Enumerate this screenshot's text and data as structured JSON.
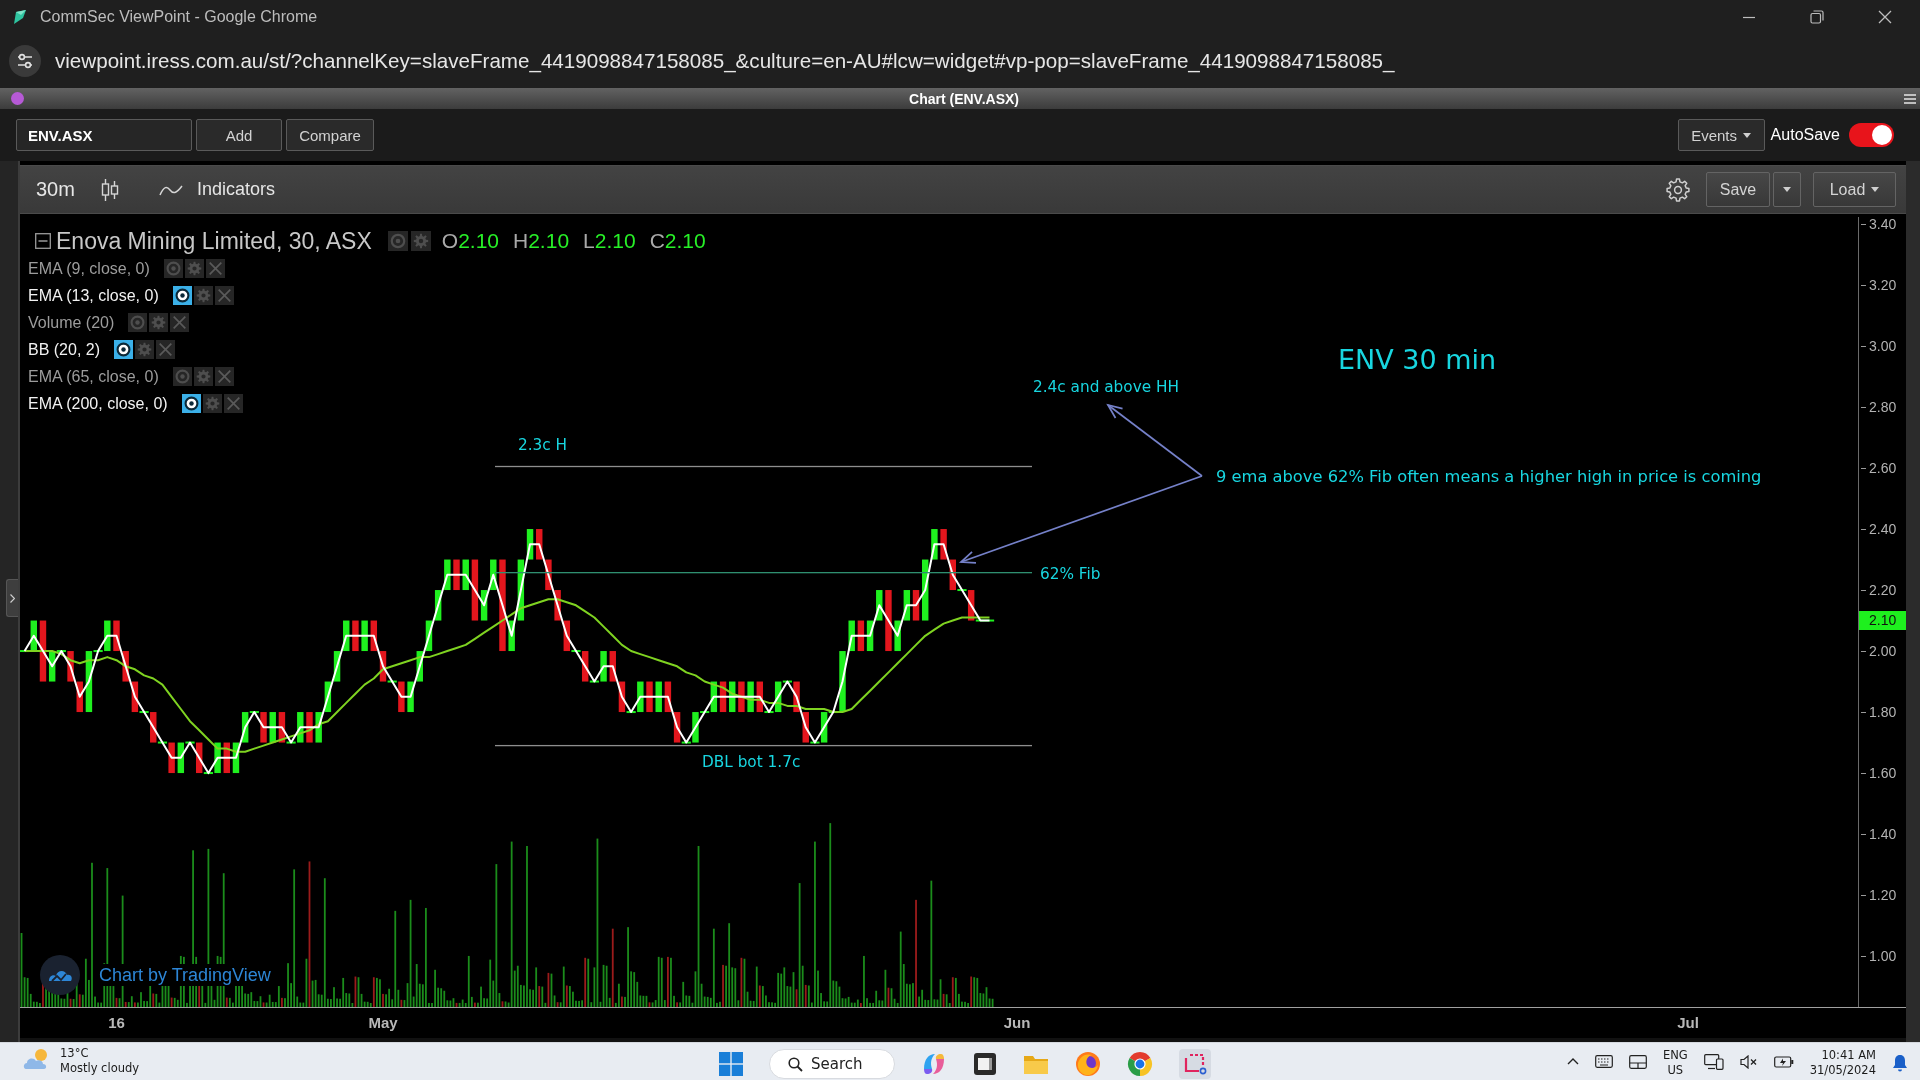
{
  "browser": {
    "title": "CommSec ViewPoint - Google Chrome",
    "url": "viewpoint.iress.com.au/st/?channelKey=slaveFrame_4419098847158085_&culture=en-AU#lcw=widget#vp-pop=slaveFrame_4419098847158085_"
  },
  "panel": {
    "title": "Chart (ENV.ASX)"
  },
  "toolbar": {
    "symbol": "ENV.ASX",
    "buttons": [
      "Add",
      "Compare"
    ],
    "events": "Events",
    "autosave": {
      "label": "AutoSave",
      "on": true
    }
  },
  "chart_toolbar": {
    "interval": "30m",
    "indicators": "Indicators",
    "save": "Save",
    "load": "Load"
  },
  "chart": {
    "legend": {
      "title": "Enova Mining Limited, 30, ASX",
      "ohlc": [
        {
          "label": "O",
          "value": "2.10"
        },
        {
          "label": "H",
          "value": "2.10"
        },
        {
          "label": "L",
          "value": "2.10"
        },
        {
          "label": "C",
          "value": "2.10"
        }
      ],
      "studies": [
        {
          "label": "EMA (9, close, 0)",
          "visible": false
        },
        {
          "label": "EMA (13, close, 0)",
          "visible": true
        },
        {
          "label": "Volume (20)",
          "visible": false
        },
        {
          "label": "BB (20, 2)",
          "visible": true
        },
        {
          "label": "EMA (65, close, 0)",
          "visible": false
        },
        {
          "label": "EMA (200, close, 0)",
          "visible": true
        }
      ]
    },
    "chart_data": {
      "type": "line",
      "title": "ENV 30 min",
      "categories": [
        null,
        null,
        null,
        null,
        null,
        null,
        null,
        null,
        null,
        null,
        "16",
        null,
        null,
        null,
        null,
        null,
        null,
        null,
        null,
        null,
        null,
        null,
        null,
        null,
        null,
        null,
        null,
        null,
        null,
        null,
        null,
        null,
        null,
        null,
        null,
        null,
        null,
        null,
        null,
        "May",
        null,
        null,
        null,
        null,
        null,
        null,
        null,
        null,
        null,
        null,
        null,
        null,
        null,
        null,
        null,
        null,
        null,
        null,
        null,
        null,
        null,
        null,
        null,
        null,
        null,
        null,
        null,
        null,
        null,
        null,
        null,
        null,
        null,
        null,
        null,
        null,
        null,
        null,
        null,
        null,
        null,
        null,
        null,
        null,
        null,
        null,
        null,
        null,
        null,
        null,
        null,
        null,
        null,
        null,
        null,
        null,
        null,
        null,
        null,
        null,
        null,
        null,
        null,
        null,
        null,
        null,
        null,
        null,
        "Jun",
        null,
        null,
        null,
        null,
        null,
        null,
        null,
        null,
        null,
        null,
        null,
        null,
        null,
        null,
        null,
        null,
        null,
        null,
        null,
        null,
        null,
        null,
        null,
        null,
        null,
        null,
        null,
        null,
        null,
        null,
        null,
        null,
        null,
        null,
        null,
        null,
        null,
        null,
        null,
        null,
        null,
        null,
        null,
        null,
        null,
        null,
        null,
        null,
        null,
        null,
        null,
        null,
        null,
        null,
        null,
        null,
        null,
        null,
        null,
        null,
        null,
        null,
        null,
        null,
        null,
        null,
        null,
        null,
        null,
        null,
        null,
        null,
        "Jul",
        null,
        null,
        null,
        null,
        null,
        null,
        null,
        null,
        null,
        null,
        null,
        null,
        null,
        null,
        null,
        null,
        null,
        null
      ],
      "ylim": [
        0.833,
        3.423
      ],
      "yticks": [
        {
          "value": 3.4,
          "label": "3.40"
        },
        {
          "value": 3.2,
          "label": "3.20"
        },
        {
          "value": 3.0,
          "label": "3.00"
        },
        {
          "value": 2.8,
          "label": "2.80"
        },
        {
          "value": 2.6,
          "label": "2.60"
        },
        {
          "value": 2.4,
          "label": "2.40"
        },
        {
          "value": 2.2,
          "label": "2.20"
        },
        {
          "value": 2.0,
          "label": "2.00"
        },
        {
          "value": 1.8,
          "label": "1.80"
        },
        {
          "value": 1.6,
          "label": "1.60"
        },
        {
          "value": 1.4,
          "label": "1.40"
        },
        {
          "value": 1.2,
          "label": "1.20"
        },
        {
          "value": 1.0,
          "label": "1.00"
        }
      ],
      "series": [
        {
          "color": "#ffffff",
          "values": [
            2.0,
            2.05,
            2.0,
            1.95,
            2.0,
            1.95,
            1.85,
            1.9,
            2.0,
            2.05,
            2.05,
            1.95,
            1.85,
            1.8,
            1.75,
            1.7,
            1.65,
            1.65,
            1.7,
            1.65,
            1.6,
            1.65,
            1.65,
            1.65,
            1.75,
            1.8,
            1.75,
            1.75,
            1.75,
            1.7,
            1.75,
            1.75,
            1.75,
            1.85,
            1.95,
            2.05,
            2.05,
            2.05,
            2.05,
            1.95,
            1.9,
            1.85,
            1.85,
            1.95,
            2.05,
            2.15,
            2.25,
            2.25,
            2.25,
            2.2,
            2.15,
            2.25,
            2.15,
            2.05,
            2.2,
            2.35,
            2.35,
            2.25,
            2.15,
            2.05,
            2.0,
            1.95,
            1.9,
            1.95,
            1.95,
            1.85,
            1.8,
            1.85,
            1.85,
            1.85,
            1.85,
            1.75,
            1.7,
            1.75,
            1.8,
            1.85,
            1.85,
            1.85,
            1.85,
            1.85,
            1.85,
            1.8,
            1.85,
            1.9,
            1.85,
            1.75,
            1.7,
            1.75,
            1.8,
            1.9,
            2.05,
            2.05,
            2.05,
            2.15,
            2.1,
            2.05,
            2.15,
            2.15,
            2.2,
            2.35,
            2.35,
            2.25,
            2.2,
            2.15,
            2.1,
            2.1,
            null,
            null,
            null,
            null,
            null,
            null,
            null,
            null,
            null,
            null,
            null,
            null,
            null,
            null,
            null,
            null,
            null,
            null,
            null,
            null,
            null,
            null,
            null,
            null,
            null,
            null,
            null,
            null,
            null,
            null,
            null,
            null,
            null,
            null,
            null,
            null,
            null,
            null,
            null,
            null,
            null,
            null,
            null,
            null,
            null,
            null,
            null,
            null,
            null,
            null,
            null,
            null,
            null,
            null,
            null,
            null,
            null,
            null,
            null,
            null,
            null,
            null,
            null,
            null,
            null,
            null,
            null,
            null,
            null,
            null,
            null,
            null,
            null,
            null,
            null,
            null,
            null,
            null,
            null,
            null,
            null,
            null,
            null,
            null,
            null,
            null,
            null,
            null,
            null,
            null,
            null,
            null,
            null,
            null
          ]
        },
        {
          "color": "#7fd321",
          "values": [
            2.0,
            2.0,
            2.0,
            2.0,
            1.99,
            1.97,
            1.96,
            1.97,
            1.97,
            1.98,
            1.97,
            1.95,
            1.94,
            1.92,
            1.91,
            1.89,
            1.85,
            1.81,
            1.77,
            1.74,
            1.71,
            1.68,
            1.68,
            1.67,
            1.67,
            1.68,
            1.69,
            1.7,
            1.71,
            1.72,
            1.73,
            1.74,
            1.76,
            1.77,
            1.8,
            1.83,
            1.86,
            1.89,
            1.91,
            1.94,
            1.95,
            1.96,
            1.97,
            1.98,
            1.98,
            1.99,
            2.0,
            2.01,
            2.02,
            2.04,
            2.06,
            2.08,
            2.1,
            2.12,
            2.14,
            2.15,
            2.16,
            2.17,
            2.17,
            2.16,
            2.15,
            2.13,
            2.11,
            2.08,
            2.05,
            2.02,
            2.0,
            1.99,
            1.98,
            1.97,
            1.96,
            1.95,
            1.93,
            1.92,
            1.9,
            1.89,
            1.88,
            1.86,
            1.85,
            1.84,
            1.84,
            1.83,
            1.83,
            1.82,
            1.82,
            1.81,
            1.81,
            1.81,
            1.8,
            1.8,
            1.81,
            1.84,
            1.87,
            1.9,
            1.93,
            1.96,
            1.99,
            2.02,
            2.05,
            2.07,
            2.09,
            2.1,
            2.11,
            2.11,
            2.11,
            2.11,
            null,
            null,
            null,
            null,
            null,
            null,
            null,
            null,
            null,
            null,
            null,
            null,
            null,
            null,
            null,
            null,
            null,
            null,
            null,
            null,
            null,
            null,
            null,
            null,
            null,
            null,
            null,
            null,
            null,
            null,
            null,
            null,
            null,
            null,
            null,
            null,
            null,
            null,
            null,
            null,
            null,
            null,
            null,
            null,
            null,
            null,
            null,
            null,
            null,
            null,
            null,
            null,
            null,
            null,
            null,
            null,
            null,
            null,
            null,
            null,
            null,
            null,
            null,
            null,
            null,
            null,
            null,
            null,
            null,
            null,
            null,
            null,
            null,
            null,
            null,
            null,
            null,
            null,
            null,
            null,
            null,
            null,
            null,
            null,
            null,
            null,
            null,
            null,
            null,
            null,
            null,
            null,
            null,
            null
          ]
        }
      ],
      "annotations": [
        {
          "text": "2.4c and above HH"
        },
        {
          "text": "2.3c H"
        },
        {
          "text": "9 ema above 62% Fib often means a higher high in price is coming"
        },
        {
          "text": "62% Fib"
        },
        {
          "text": "DBL bot 1.7c"
        }
      ]
    },
    "last_price": "2.10",
    "attribution": "Chart by TradingView"
  },
  "taskbar": {
    "weather": {
      "temperature": "13°C",
      "condition": "Mostly cloudy"
    },
    "search": "Search",
    "language": "ENG",
    "region": "US",
    "time": "10:41 AM",
    "date": "31/05/2024"
  }
}
